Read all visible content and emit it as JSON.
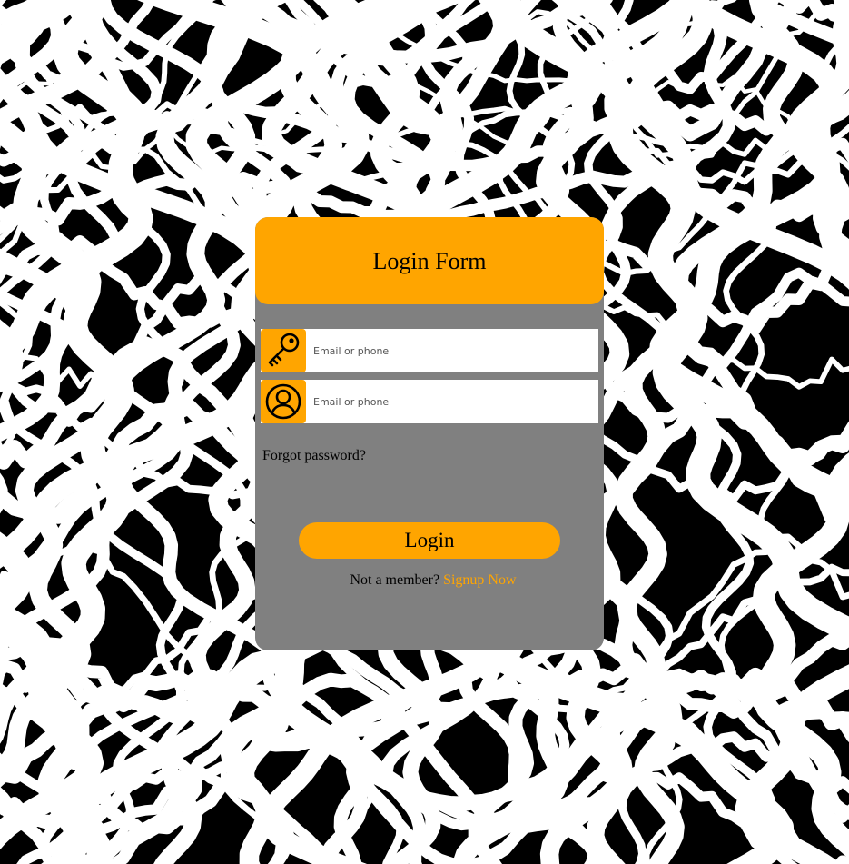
{
  "form": {
    "title": "Login Form",
    "fields": [
      {
        "icon": "key-icon",
        "placeholder": "Email or phone",
        "value": ""
      },
      {
        "icon": "user-icon",
        "placeholder": "Email or phone",
        "value": ""
      }
    ],
    "forgot_label": "Forgot password?",
    "login_label": "Login",
    "signup_prompt": "Not a member?",
    "signup_link": "Signup Now"
  },
  "colors": {
    "accent": "#ffa500",
    "card_body": "#808080",
    "background_dark": "#000000",
    "background_light": "#ffffff"
  }
}
